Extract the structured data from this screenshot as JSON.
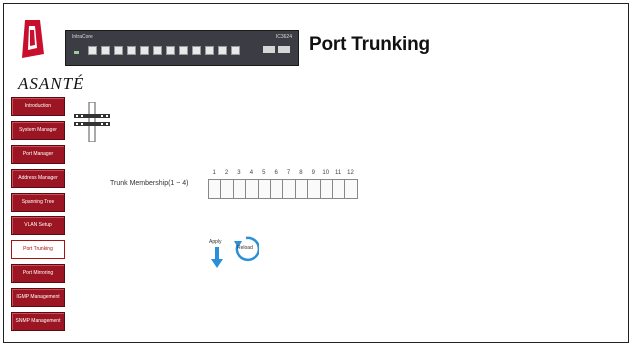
{
  "brand": {
    "name": "ASANTÉ",
    "logo_color": "#c8102e"
  },
  "switch": {
    "model": "IntraCore",
    "tag": "IC3624"
  },
  "page": {
    "title": "Port Trunking"
  },
  "sidebar": {
    "items": [
      {
        "label": "Introduction"
      },
      {
        "label": "System Manager"
      },
      {
        "label": "Port Manager"
      },
      {
        "label": "Address Manager"
      },
      {
        "label": "Spanning Tree"
      },
      {
        "label": "VLAN Setup"
      },
      {
        "label": "Port Trunking",
        "active": true
      },
      {
        "label": "Port Mirroring"
      },
      {
        "label": "IGMP Management"
      },
      {
        "label": "SNMP Management"
      }
    ]
  },
  "trunk": {
    "label": "Trunk Membership(1 ~ 4)",
    "ports": [
      "1",
      "2",
      "3",
      "4",
      "5",
      "6",
      "7",
      "8",
      "9",
      "10",
      "11",
      "12"
    ]
  },
  "actions": {
    "apply_label": "Apply",
    "reload_label": "Reload"
  },
  "colors": {
    "nav_bg": "#9b1622",
    "accent": "#2a8fd6"
  }
}
